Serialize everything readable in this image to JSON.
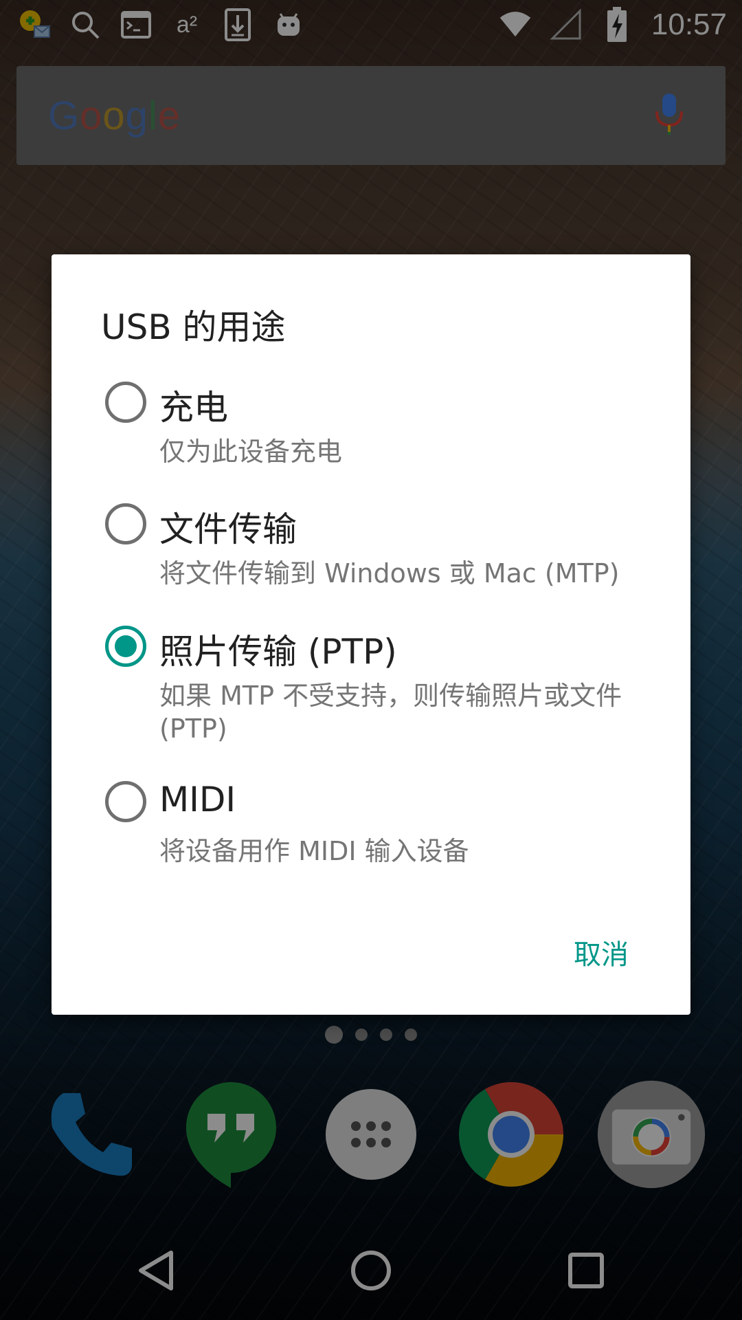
{
  "status_bar": {
    "time": "10:57",
    "superscript_text": "a²",
    "icons": [
      "mail-alert-icon",
      "search-icon",
      "terminal-icon",
      "superscript-icon",
      "download-icon",
      "android-robot-icon",
      "wifi-icon",
      "signal-icon",
      "battery-charging-icon"
    ]
  },
  "search": {
    "logo": "Google",
    "mic_icon": "mic-icon"
  },
  "dialog": {
    "title": "USB 的用途",
    "options": [
      {
        "label": "充电",
        "description": "仅为此设备充电",
        "selected": false
      },
      {
        "label": "文件传输",
        "description": "将文件传输到 Windows 或 Mac (MTP)",
        "selected": false
      },
      {
        "label": "照片传输 (PTP)",
        "description": "如果 MTP 不受支持，则传输照片或文件 (PTP)",
        "selected": true
      },
      {
        "label": "MIDI",
        "description": "将设备用作 MIDI 输入设备",
        "selected": false
      }
    ],
    "cancel_label": "取消"
  },
  "dock": {
    "apps": [
      "phone-icon",
      "hangouts-icon",
      "app-drawer-icon",
      "chrome-icon",
      "camera-icon"
    ]
  },
  "pager": {
    "pages": 4,
    "current": 1
  },
  "colors": {
    "accent": "#009688",
    "google_blue": "#4285F4",
    "google_red": "#EA4335",
    "google_yellow": "#FBBC05",
    "google_green": "#34A853"
  }
}
